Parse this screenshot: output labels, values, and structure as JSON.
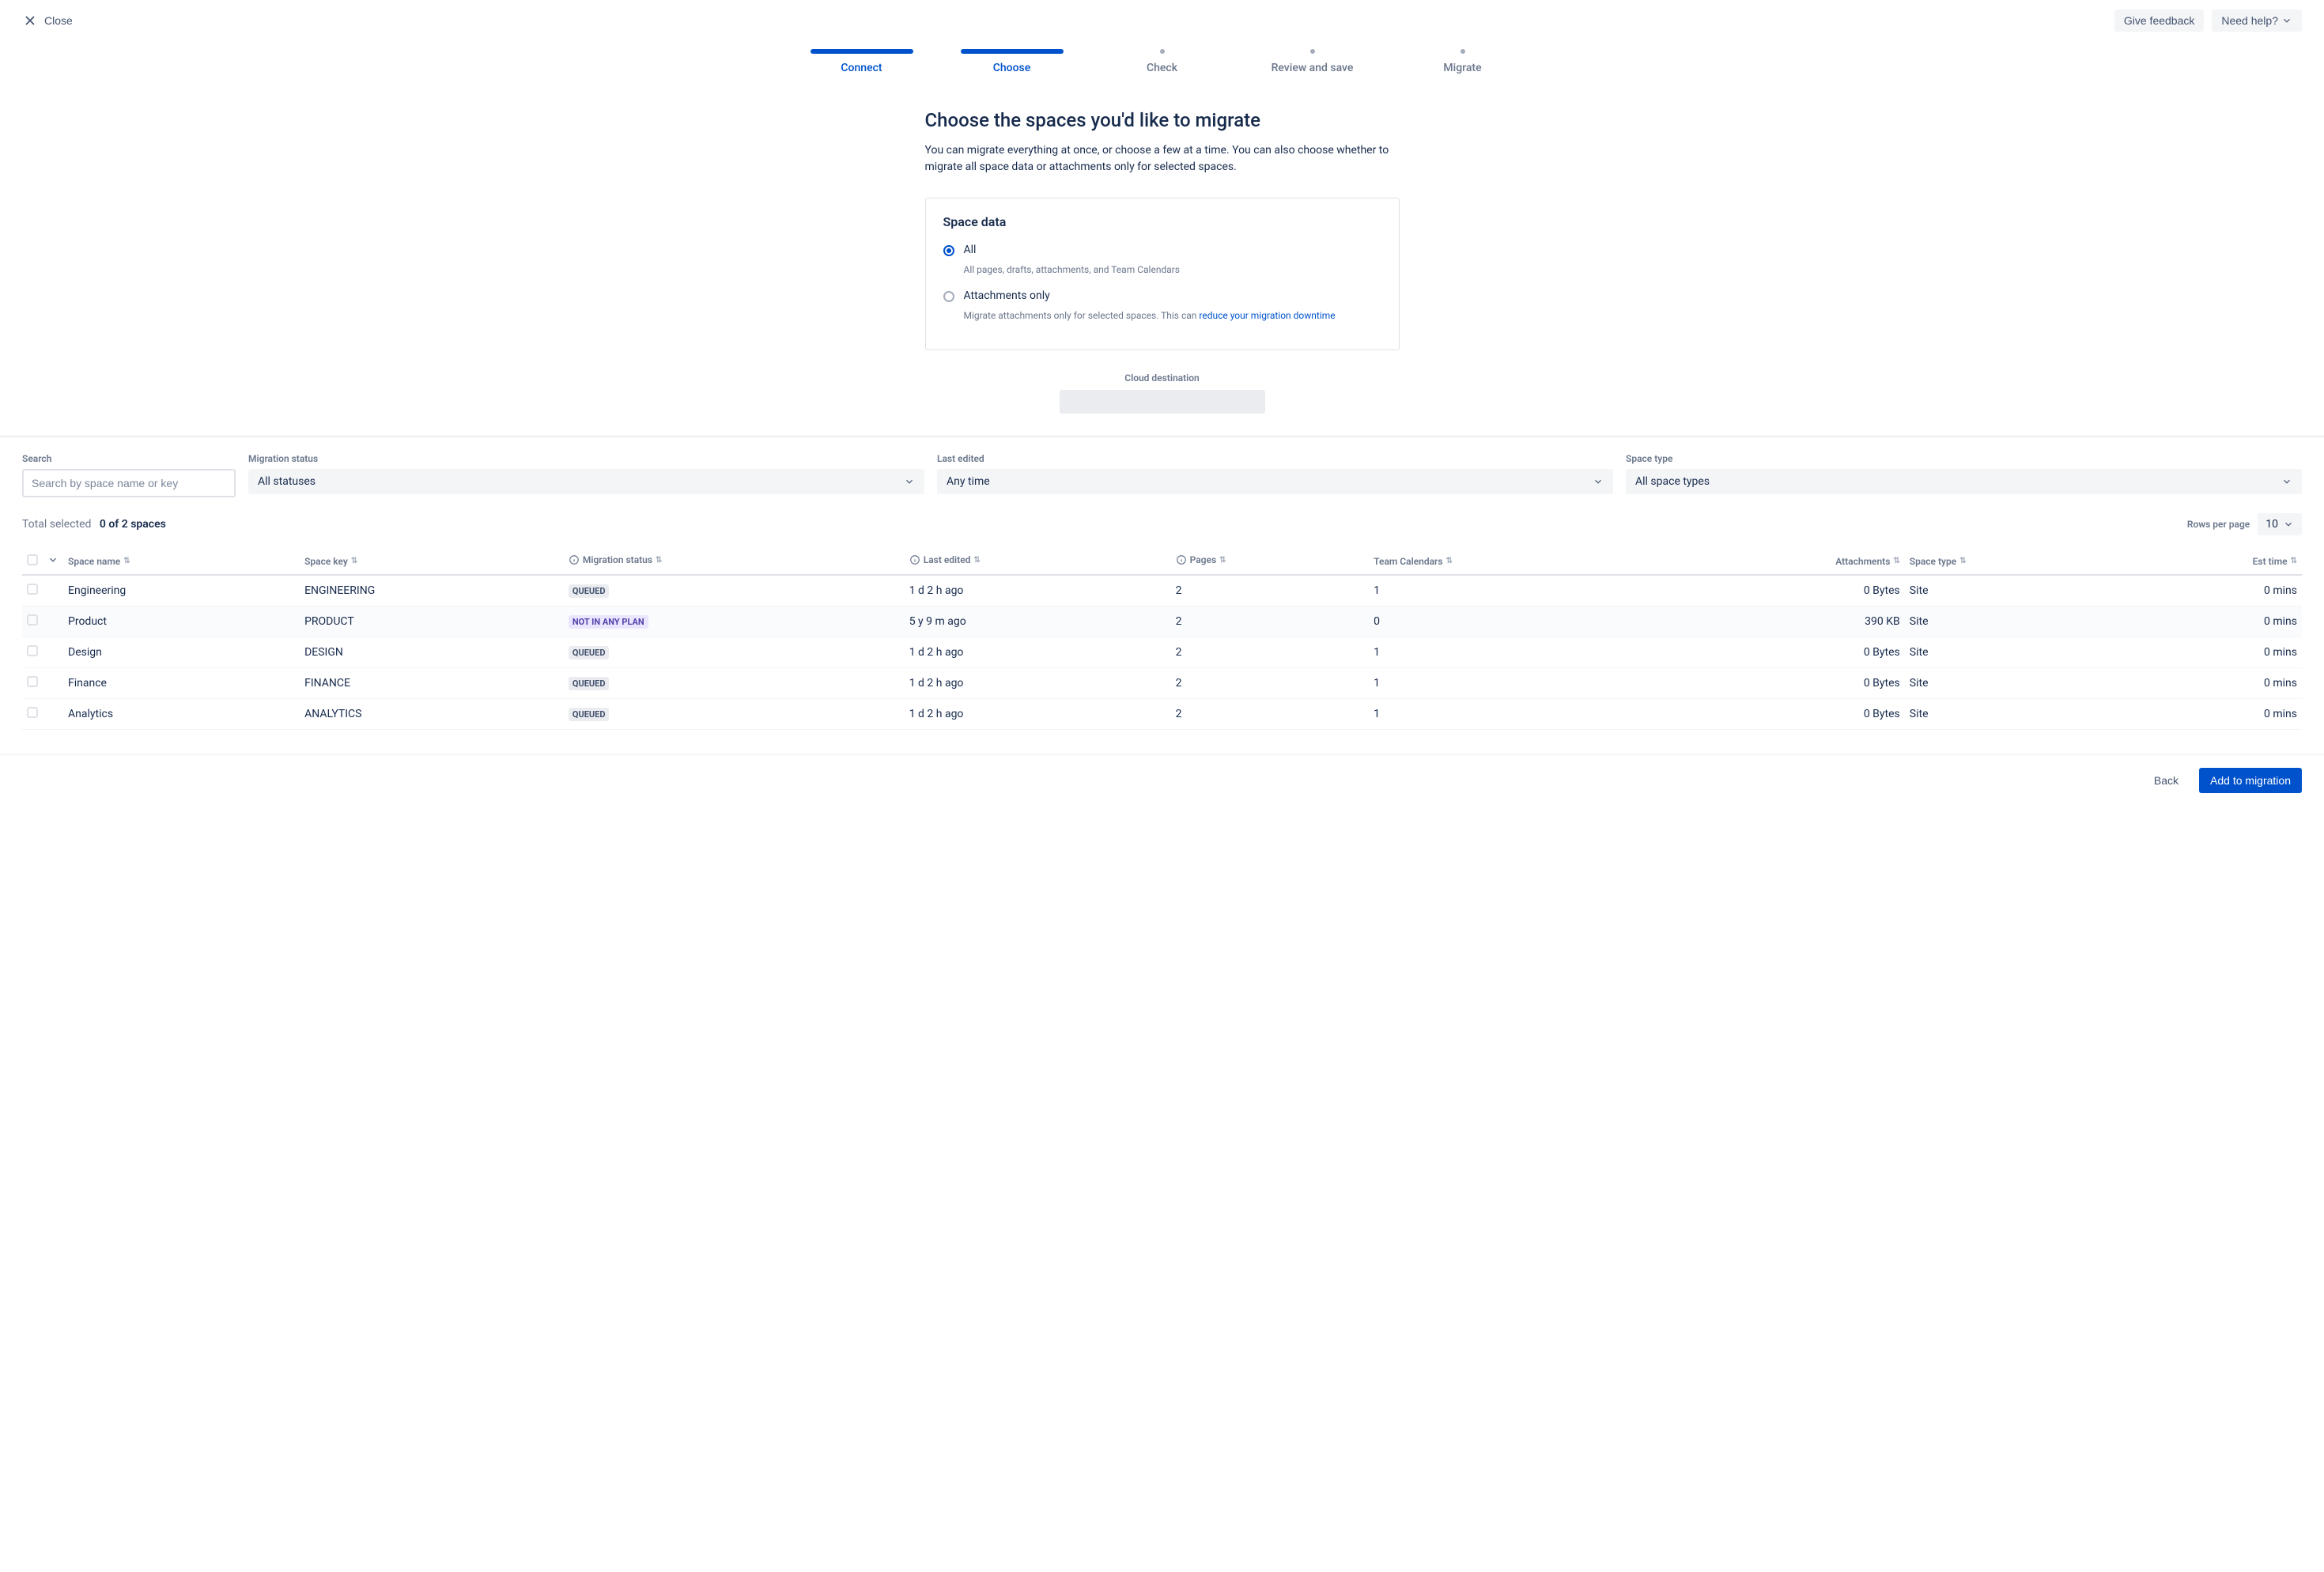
{
  "topbar": {
    "close": "Close",
    "feedback": "Give feedback",
    "help": "Need help?"
  },
  "stepper": {
    "connect": "Connect",
    "choose": "Choose",
    "check": "Check",
    "review": "Review and save",
    "migrate": "Migrate"
  },
  "heading": "Choose the spaces you'd like to migrate",
  "subheading": "You can migrate everything at once, or choose a few at a time. You can also choose whether to migrate all space data or attachments only for selected spaces.",
  "panel": {
    "title": "Space data",
    "opt_all_label": "All",
    "opt_all_desc": "All pages, drafts, attachments, and Team Calendars",
    "opt_att_label": "Attachments only",
    "opt_att_desc_prefix": "Migrate attachments only for selected spaces. This can ",
    "opt_att_link": "reduce your migration downtime"
  },
  "cloud_destination_label": "Cloud destination",
  "filters": {
    "search_label": "Search",
    "search_placeholder": "Search by space name or key",
    "status_label": "Migration status",
    "status_value": "All statuses",
    "edited_label": "Last edited",
    "edited_value": "Any time",
    "type_label": "Space type",
    "type_value": "All space types"
  },
  "summary": {
    "total_label": "Total selected",
    "count": "0 of 2 spaces",
    "rows_label": "Rows per page",
    "rows_value": "10"
  },
  "columns": {
    "name": "Space name",
    "key": "Space key",
    "status": "Migration status",
    "edited": "Last edited",
    "pages": "Pages",
    "calendars": "Team Calendars",
    "attachments": "Attachments",
    "type": "Space type",
    "est": "Est time"
  },
  "status_labels": {
    "queued": "QUEUED",
    "not_in_plan": "NOT IN ANY PLAN"
  },
  "rows": [
    {
      "name": "Engineering",
      "key": "ENGINEERING",
      "status": "queued",
      "edited": "1 d 2 h ago",
      "pages": "2",
      "calendars": "1",
      "attachments": "0 Bytes",
      "type": "Site",
      "est": "0 mins"
    },
    {
      "name": "Product",
      "key": "PRODUCT",
      "status": "not_in_plan",
      "edited": "5 y 9 m ago",
      "pages": "2",
      "calendars": "0",
      "attachments": "390 KB",
      "type": "Site",
      "est": "0 mins"
    },
    {
      "name": "Design",
      "key": "DESIGN",
      "status": "queued",
      "edited": "1 d 2 h ago",
      "pages": "2",
      "calendars": "1",
      "attachments": "0 Bytes",
      "type": "Site",
      "est": "0 mins"
    },
    {
      "name": "Finance",
      "key": "FINANCE",
      "status": "queued",
      "edited": "1 d 2 h ago",
      "pages": "2",
      "calendars": "1",
      "attachments": "0 Bytes",
      "type": "Site",
      "est": "0 mins"
    },
    {
      "name": "Analytics",
      "key": "ANALYTICS",
      "status": "queued",
      "edited": "1 d 2 h ago",
      "pages": "2",
      "calendars": "1",
      "attachments": "0 Bytes",
      "type": "Site",
      "est": "0 mins"
    }
  ],
  "footer": {
    "back": "Back",
    "add": "Add to migration"
  }
}
